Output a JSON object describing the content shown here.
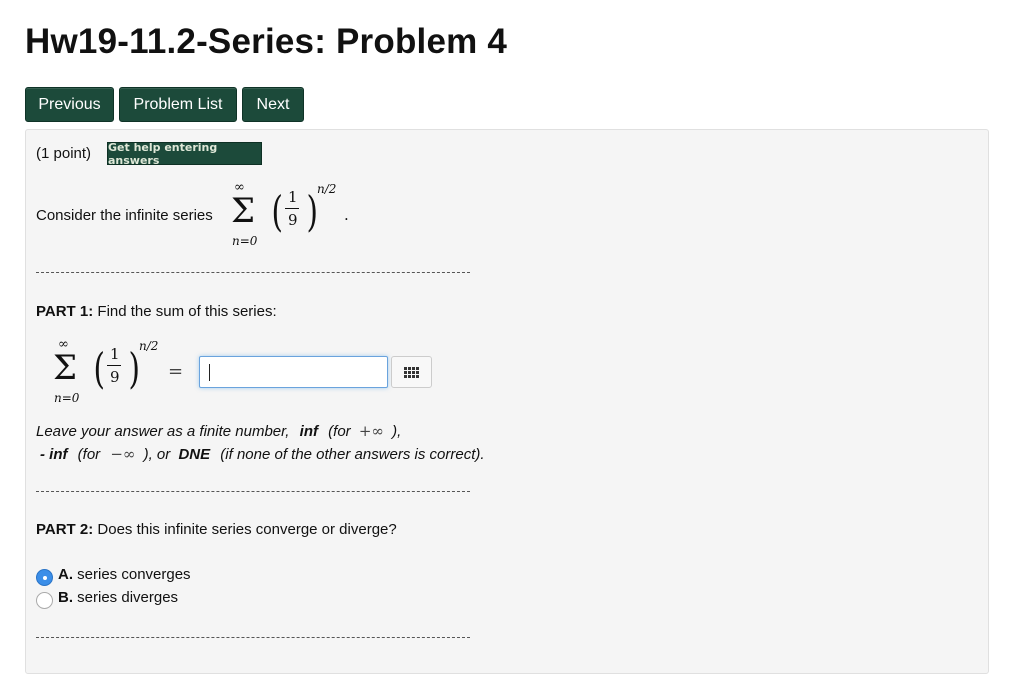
{
  "page": {
    "title": "Hw19-11.2-Series: Problem 4"
  },
  "nav": {
    "previous": "Previous",
    "problem_list": "Problem List",
    "next": "Next"
  },
  "problem": {
    "points": "(1 point)",
    "help_button": "Get help entering answers",
    "intro": "Consider the infinite series",
    "series": {
      "sum_upper": "∞",
      "sum_lower": "n=0",
      "sigma": "Σ",
      "numerator": "1",
      "denominator": "9",
      "exponent": "n/2",
      "period": "."
    }
  },
  "part1": {
    "label": "PART 1:",
    "text": "Find the sum of this series:",
    "equals": "=",
    "answer_value": "",
    "instructions": {
      "line1_a": "Leave your answer as a finite number,",
      "inf": "inf",
      "for_open": "(for",
      "plus_inf": "+∞",
      "close": "),",
      "neg_inf_word": "- inf",
      "for_open2": "(for",
      "minus_inf": "−∞",
      "or": "), or",
      "dne": "DNE",
      "dne_note": "(if none of the other answers is correct)."
    }
  },
  "part2": {
    "label": "PART 2:",
    "text": "Does this infinite series converge or diverge?",
    "options": [
      {
        "letter": "A.",
        "text": "series converges",
        "selected": true
      },
      {
        "letter": "B.",
        "text": "series diverges",
        "selected": false
      }
    ]
  }
}
